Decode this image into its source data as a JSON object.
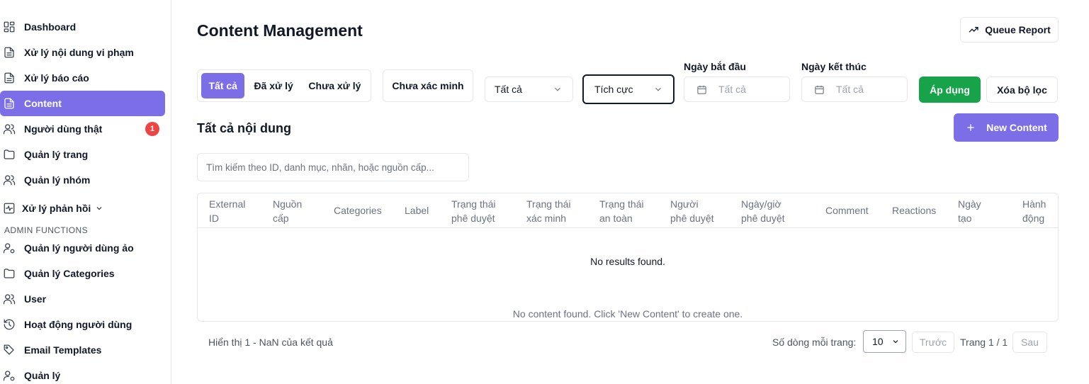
{
  "sidebar": {
    "items": [
      {
        "label": "Dashboard",
        "icon": "dashboard-icon"
      },
      {
        "label": "Xử lý nội dung vi phạm",
        "icon": "document-icon"
      },
      {
        "label": "Xử lý báo cáo",
        "icon": "document-icon"
      },
      {
        "label": "Content",
        "icon": "document-icon",
        "active": true
      },
      {
        "label": "Người dùng thật",
        "icon": "users-icon",
        "badge": "1"
      },
      {
        "label": "Quản lý trang",
        "icon": "folder-icon"
      },
      {
        "label": "Quản lý nhóm",
        "icon": "users-icon"
      },
      {
        "label": "Xử lý phản hồi",
        "icon": "activity-icon"
      },
      {
        "label": "Quản lý người dùng ảo",
        "icon": "user-cog-icon"
      },
      {
        "label": "Quản lý Categories",
        "icon": "folder-icon"
      },
      {
        "label": "User",
        "icon": "users-icon"
      },
      {
        "label": "Hoạt động người dùng",
        "icon": "history-icon"
      },
      {
        "label": "Email Templates",
        "icon": "tag-icon"
      },
      {
        "label": "Quản lý",
        "icon": "user-cog-icon"
      }
    ],
    "section_label": "ADMIN FUNCTIONS"
  },
  "header": {
    "title": "Content Management",
    "queue_report_label": "Queue Report"
  },
  "filters": {
    "tabs": [
      "Tất cả",
      "Đã xử lý",
      "Chưa xử lý"
    ],
    "unverified_label": "Chưa xác minh",
    "status_select": "Tất cả",
    "sentiment_select": "Tích cực",
    "start_date_label": "Ngày bắt đầu",
    "start_date_value": "Tất cả",
    "end_date_label": "Ngày kết thúc",
    "end_date_value": "Tất cả",
    "apply_label": "Áp dụng",
    "clear_label": "Xóa bộ lọc"
  },
  "content": {
    "section_title": "Tất cả nội dung",
    "new_content_label": "New Content",
    "search_placeholder": "Tìm kiếm theo ID, danh mục, nhãn, hoặc nguồn cấp..."
  },
  "table": {
    "columns": [
      [
        "External",
        "ID"
      ],
      [
        "Nguồn",
        "cấp"
      ],
      [
        "Categories"
      ],
      [
        "Label"
      ],
      [
        "Trạng thái",
        "phê duyệt"
      ],
      [
        "Trạng thái",
        "xác minh"
      ],
      [
        "Trạng thái",
        "an toàn"
      ],
      [
        "Người",
        "phê duyệt"
      ],
      [
        "Ngày/giờ",
        "phê duyệt"
      ],
      [
        "Comment"
      ],
      [
        "Reactions"
      ],
      [
        "Ngày",
        "tạo"
      ],
      [
        "Hành",
        "động"
      ]
    ],
    "empty_message": "No results found.",
    "empty_hint": "No content found. Click 'New Content' to create one."
  },
  "pagination": {
    "summary": "Hiển thị 1 - NaN của kết quả",
    "rows_per_page_label": "Số dòng mỗi trang:",
    "rows_per_page": "10",
    "prev_label": "Trước",
    "page_info": "Trang 1 / 1",
    "next_label": "Sau"
  },
  "colors": {
    "accent": "#7c6ee6",
    "apply": "#16a34a",
    "badge": "#ef4444"
  }
}
